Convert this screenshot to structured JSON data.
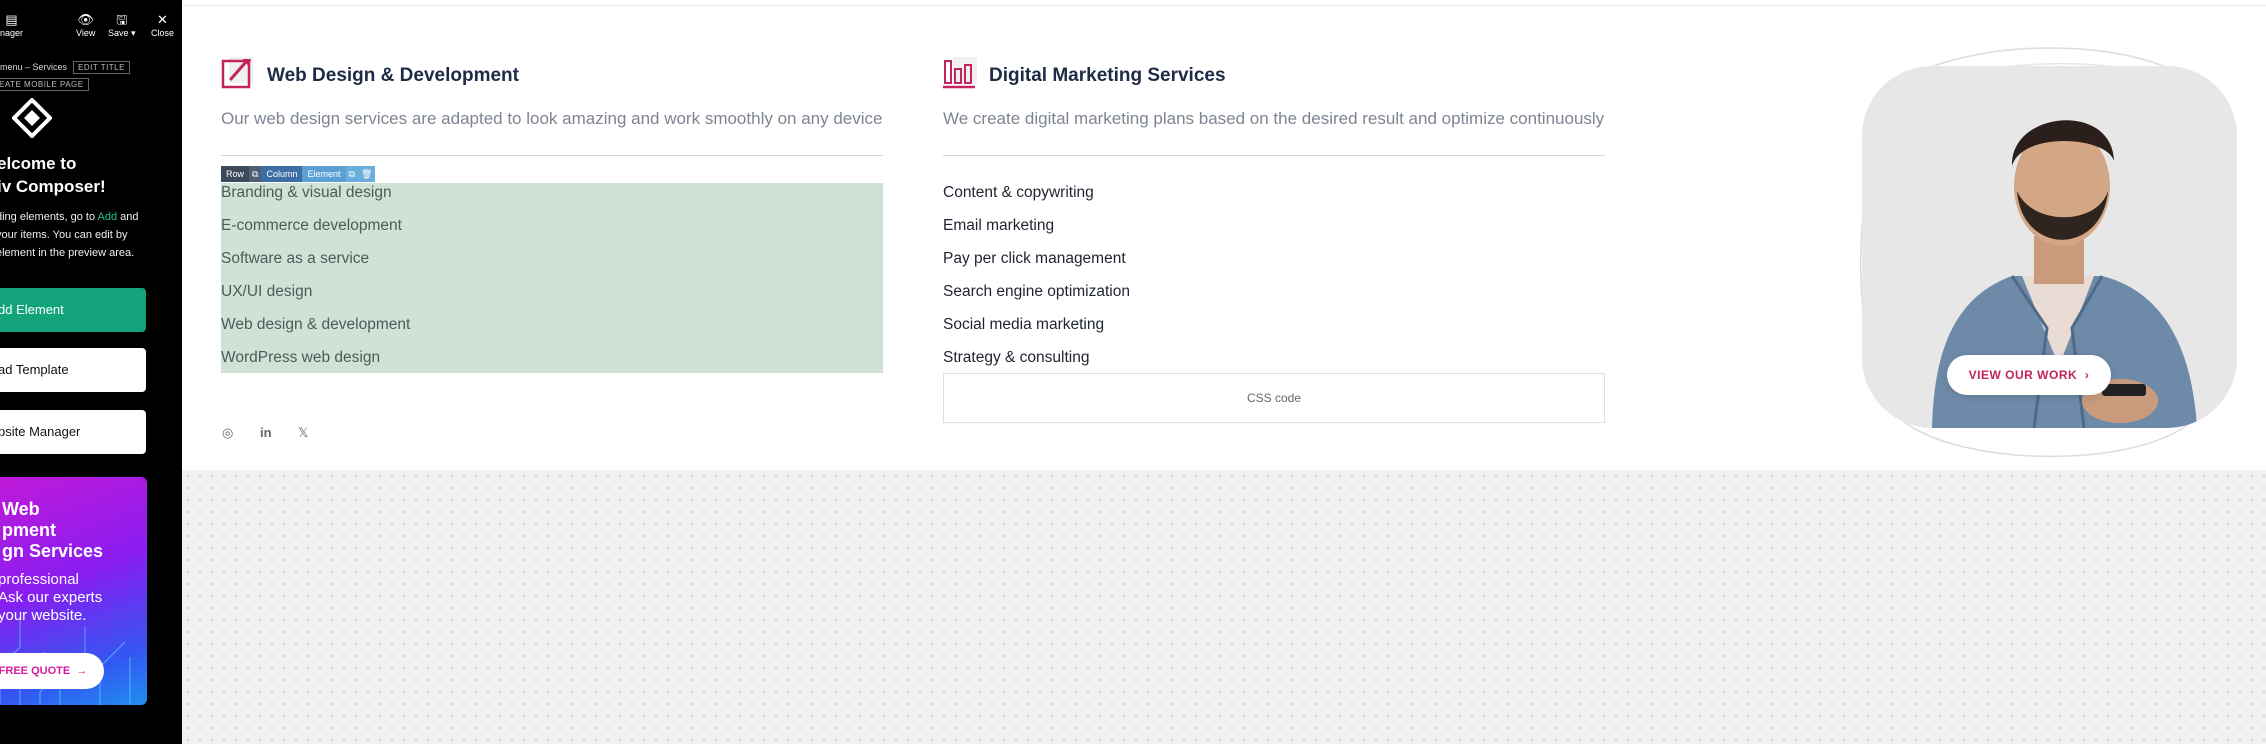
{
  "editor": {
    "toolbar": {
      "manager_label": "nager",
      "view_label": "View",
      "save_label": "Save",
      "close_label": "Close"
    },
    "breadcrumb": "menu – Services",
    "edit_title_label": "EDIT TITLE",
    "mobile_page_label": "EATE MOBILE PAGE",
    "welcome_title_line1": "elcome to",
    "welcome_title_line2": "iv Composer!",
    "desc_line1_pre": "ding elements, go to ",
    "desc_add": "Add",
    "desc_line1_post": " and",
    "desc_line2": " your items. You can edit by",
    "desc_line3": "element in the preview area.",
    "add_element_label": "dd Element",
    "template_label": "ad Template",
    "website_manager_label": "psite Manager",
    "promo": {
      "title_line1": "Web",
      "title_line2": "pment",
      "title_line3": "gn Services",
      "desc_line1": "professional",
      "desc_line2": "Ask our experts",
      "desc_line3": " your website.",
      "button_label": "FREE QUOTE"
    }
  },
  "web_design": {
    "title": "Web Design & Development",
    "subtitle": "Our web design services are adapted to look amazing and work smoothly on any device",
    "toolbar": {
      "row": "Row",
      "column": "Column",
      "element": "Element"
    },
    "items": [
      "Branding & visual design",
      "E-commerce development",
      "Software as a service",
      "UX/UI design",
      "Web design & development",
      "WordPress web design"
    ]
  },
  "digital_marketing": {
    "title": "Digital Marketing Services",
    "subtitle": "We create digital marketing plans based on the desired result and optimize continuously",
    "items": [
      "Content & copywriting",
      "Email marketing",
      "Pay per click management",
      "Search engine optimization",
      "Social media marketing",
      "Strategy & consulting"
    ],
    "css_box_label": "CSS code"
  },
  "hero_card": {
    "button_label": "VIEW OUR WORK"
  },
  "colors": {
    "accent": "#c1245e",
    "editor_green": "#12a37a",
    "highlight": "#cfe2d6"
  }
}
